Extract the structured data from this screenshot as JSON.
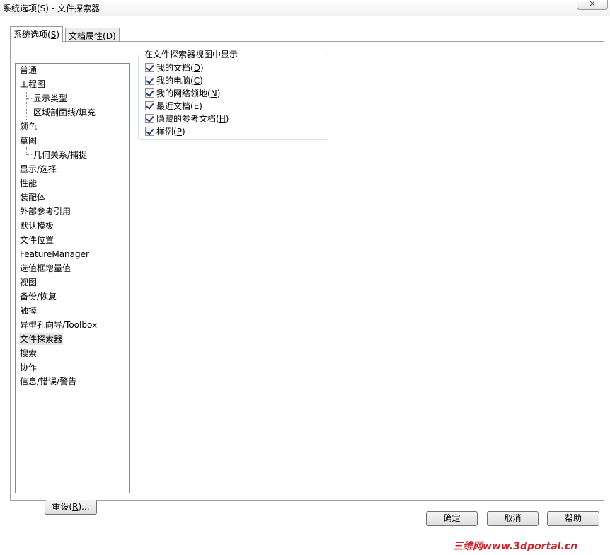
{
  "window": {
    "title": "系统选项(S) - 文件探索器",
    "close_glyph": "✕"
  },
  "tabs": [
    {
      "label": "系统选项",
      "mnemonic": "S"
    },
    {
      "label": "文档属性",
      "mnemonic": "D"
    }
  ],
  "tree": {
    "items": [
      {
        "label": "普通",
        "level": 0
      },
      {
        "label": "工程图",
        "level": 0
      },
      {
        "label": "显示类型",
        "level": 1
      },
      {
        "label": "区域剖面线/填充",
        "level": 1
      },
      {
        "label": "颜色",
        "level": 0
      },
      {
        "label": "草图",
        "level": 0
      },
      {
        "label": "几何关系/捕捉",
        "level": 1
      },
      {
        "label": "显示/选择",
        "level": 0
      },
      {
        "label": "性能",
        "level": 0
      },
      {
        "label": "装配体",
        "level": 0
      },
      {
        "label": "外部参考引用",
        "level": 0
      },
      {
        "label": "默认模板",
        "level": 0
      },
      {
        "label": "文件位置",
        "level": 0
      },
      {
        "label": "FeatureManager",
        "level": 0
      },
      {
        "label": "选值框增量值",
        "level": 0
      },
      {
        "label": "视图",
        "level": 0
      },
      {
        "label": "备份/恢复",
        "level": 0
      },
      {
        "label": "触摸",
        "level": 0
      },
      {
        "label": "异型孔向导/Toolbox",
        "level": 0
      },
      {
        "label": "文件探索器",
        "level": 0,
        "selected": true
      },
      {
        "label": "搜索",
        "level": 0
      },
      {
        "label": "协作",
        "level": 0
      },
      {
        "label": "信息/错误/警告",
        "level": 0
      }
    ]
  },
  "group": {
    "legend": "在文件探索器视图中显示",
    "options": [
      {
        "label": "我的文档",
        "mnemonic": "D",
        "checked": true
      },
      {
        "label": "我的电脑",
        "mnemonic": "C",
        "checked": true
      },
      {
        "label": "我的网络领地",
        "mnemonic": "N",
        "checked": true
      },
      {
        "label": "最近文档",
        "mnemonic": "E",
        "checked": true
      },
      {
        "label": "隐藏的参考文档",
        "mnemonic": "H",
        "checked": true
      },
      {
        "label": "样例",
        "mnemonic": "P",
        "checked": true
      }
    ]
  },
  "buttons": {
    "reset": {
      "label": "重设",
      "mnemonic": "R",
      "suffix": "..."
    },
    "ok": "确定",
    "cancel": "取消",
    "help": "帮助"
  },
  "watermark": {
    "text": "三维网www.3dportal.cn",
    "color": "#d0202a"
  }
}
